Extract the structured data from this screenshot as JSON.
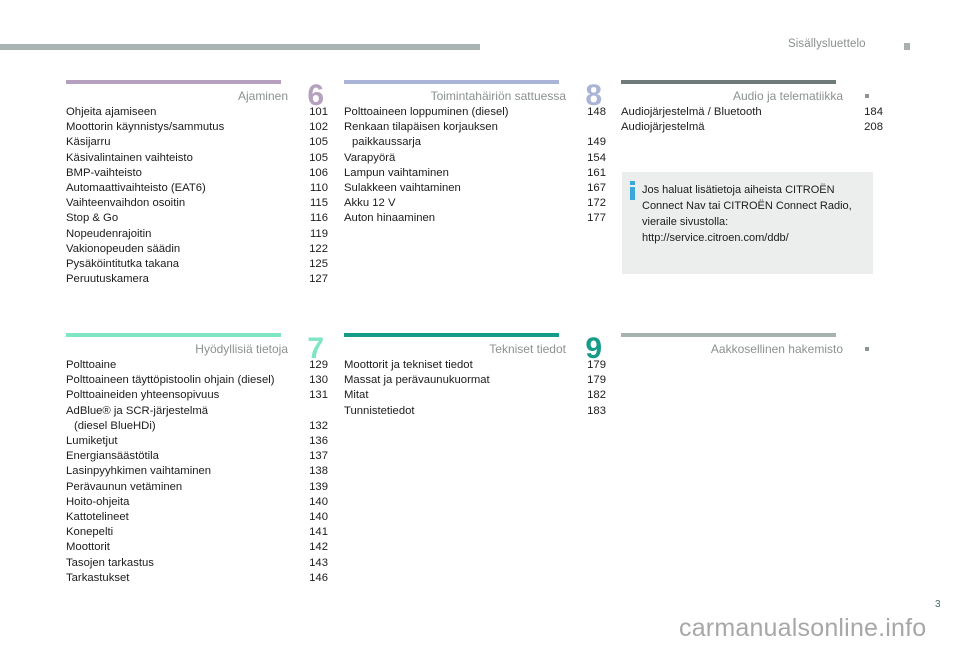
{
  "header": {
    "title": "Sisällysluettelo"
  },
  "colors": {
    "section6": "#b5a1bd",
    "section8": "#aab4d6",
    "section_audio": "#6e7b79",
    "section7": "#7fe6c4",
    "section9": "#159b87",
    "section_index": "#a6b3b0",
    "info_accent": "#3aa8dd"
  },
  "sections": [
    {
      "id": "ajaminen",
      "title": "Ajaminen",
      "number": "6",
      "entries": [
        {
          "label": "Ohjeita ajamiseen",
          "page": "101"
        },
        {
          "label": "Moottorin käynnistys/sammutus",
          "page": "102"
        },
        {
          "label": "Käsijarru",
          "page": "105"
        },
        {
          "label": "Käsivalintainen vaihteisto",
          "page": "105"
        },
        {
          "label": "BMP-vaihteisto",
          "page": "106"
        },
        {
          "label": "Automaattivaihteisto (EAT6)",
          "page": "110"
        },
        {
          "label": "Vaihteenvaihdon osoitin",
          "page": "115"
        },
        {
          "label": "Stop & Go",
          "page": "116"
        },
        {
          "label": "Nopeudenrajoitin",
          "page": "119"
        },
        {
          "label": "Vakionopeuden säädin",
          "page": "122"
        },
        {
          "label": "Pysäköintitutka takana",
          "page": "125"
        },
        {
          "label": "Peruutuskamera",
          "page": "127"
        }
      ]
    },
    {
      "id": "toimintahairio",
      "title": "Toimintahäiriön sattuessa",
      "number": "8",
      "entries": [
        {
          "label": "Polttoaineen loppuminen (diesel)",
          "page": "148"
        },
        {
          "label": "Renkaan tilapäisen korjauksen",
          "cont": "paikkaussarja",
          "page": "149"
        },
        {
          "label": "Varapyörä",
          "page": "154"
        },
        {
          "label": "Lampun vaihtaminen",
          "page": "161"
        },
        {
          "label": "Sulakkeen vaihtaminen",
          "page": "167"
        },
        {
          "label": "Akku 12 V",
          "page": "172"
        },
        {
          "label": "Auton hinaaminen",
          "page": "177"
        }
      ]
    },
    {
      "id": "audio",
      "title": "Audio ja telematiikka",
      "number": "",
      "entries": [
        {
          "label": "Audiojärjestelmä / Bluetooth",
          "page": "184"
        },
        {
          "label": "Audiojärjestelmä",
          "page": "208"
        }
      ]
    },
    {
      "id": "hyodyllisia",
      "title": "Hyödyllisiä tietoja",
      "number": "7",
      "entries": [
        {
          "label": "Polttoaine",
          "page": "129"
        },
        {
          "label": "Polttoaineen täyttöpistoolin ohjain (diesel)",
          "page": "130"
        },
        {
          "label": "Polttoaineiden yhteensopivuus",
          "page": "131"
        },
        {
          "label": "AdBlue® ja SCR-järjestelmä",
          "cont": "(diesel BlueHDi)",
          "page": "132"
        },
        {
          "label": "Lumiketjut",
          "page": "136"
        },
        {
          "label": "Energiansäästötila",
          "page": "137"
        },
        {
          "label": "Lasinpyyhkimen vaihtaminen",
          "page": "138"
        },
        {
          "label": "Perävaunun vetäminen",
          "page": "139"
        },
        {
          "label": "Hoito-ohjeita",
          "page": "140"
        },
        {
          "label": "Kattotelineet",
          "page": "140"
        },
        {
          "label": "Konepelti",
          "page": "141"
        },
        {
          "label": "Moottorit",
          "page": "142"
        },
        {
          "label": "Tasojen tarkastus",
          "page": "143"
        },
        {
          "label": "Tarkastukset",
          "page": "146"
        }
      ]
    },
    {
      "id": "tekniset",
      "title": "Tekniset tiedot",
      "number": "9",
      "entries": [
        {
          "label": "Moottorit ja tekniset tiedot",
          "page": "179"
        },
        {
          "label": "Massat ja perävaunukuormat",
          "page": "179"
        },
        {
          "label": "Mitat",
          "page": "182"
        },
        {
          "label": "Tunnistetiedot",
          "page": "183"
        }
      ]
    },
    {
      "id": "hakemisto",
      "title": "Aakkosellinen hakemisto",
      "number": "",
      "entries": []
    }
  ],
  "info_box": {
    "text_lines": [
      "Jos haluat lisätietoja aiheista CITROËN",
      "Connect Nav tai CITROËN Connect Radio,",
      "vieraile sivustolla:",
      "http://service.citroen.com/ddb/"
    ]
  },
  "footer": {
    "page_number": "3",
    "watermark": "carmanualsonline.info"
  }
}
